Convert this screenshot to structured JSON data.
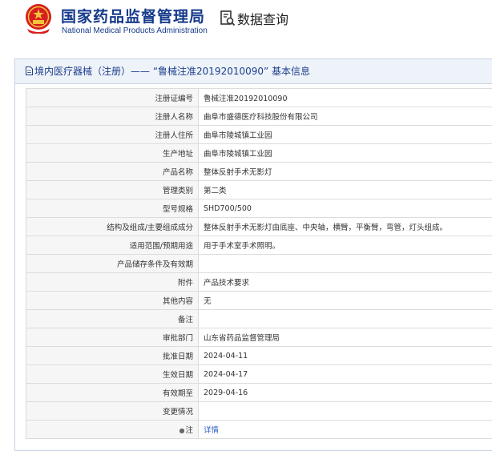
{
  "header": {
    "org_name_cn": "国家药品监督管理局",
    "org_name_en": "National Medical Products Administration",
    "query_label": "数据查询",
    "emblem_icon": "national-emblem-icon",
    "query_icon": "search-doc-icon"
  },
  "panel": {
    "title": "境内医疗器械（注册）—— “鲁械注准20192010090” 基本信息"
  },
  "rows": [
    {
      "label": "注册证编号",
      "value": "鲁械注准20192010090"
    },
    {
      "label": "注册人名称",
      "value": "曲阜市盛德医疗科技股份有限公司"
    },
    {
      "label": "注册人住所",
      "value": "曲阜市陵城镇工业园"
    },
    {
      "label": "生产地址",
      "value": "曲阜市陵城镇工业园"
    },
    {
      "label": "产品名称",
      "value": "整体反射手术无影灯"
    },
    {
      "label": "管理类别",
      "value": "第二类"
    },
    {
      "label": "型号规格",
      "value": "SHD700/500"
    },
    {
      "label": "结构及组成/主要组成成分",
      "value": "整体反射手术无影灯由底座、中央轴，横臂，平衡臂，弯管，灯头组成。"
    },
    {
      "label": "适用范围/预期用途",
      "value": "用于手术室手术照明。"
    },
    {
      "label": "产品储存条件及有效期",
      "value": ""
    },
    {
      "label": "附件",
      "value": "产品技术要求"
    },
    {
      "label": "其他内容",
      "value": "无"
    },
    {
      "label": "备注",
      "value": ""
    },
    {
      "label": "审批部门",
      "value": "山东省药品监督管理局"
    },
    {
      "label": "批准日期",
      "value": "2024-04-11"
    },
    {
      "label": "生效日期",
      "value": "2024-04-17"
    },
    {
      "label": "有效期至",
      "value": "2029-04-16"
    },
    {
      "label": "变更情况",
      "value": ""
    },
    {
      "label": "注",
      "value": "详情"
    }
  ],
  "colors": {
    "brand_blue": "#163a8c",
    "link_blue": "#2a5bbf",
    "label_bg": "#f6f6f6",
    "title_bg": "#eef3f9"
  }
}
